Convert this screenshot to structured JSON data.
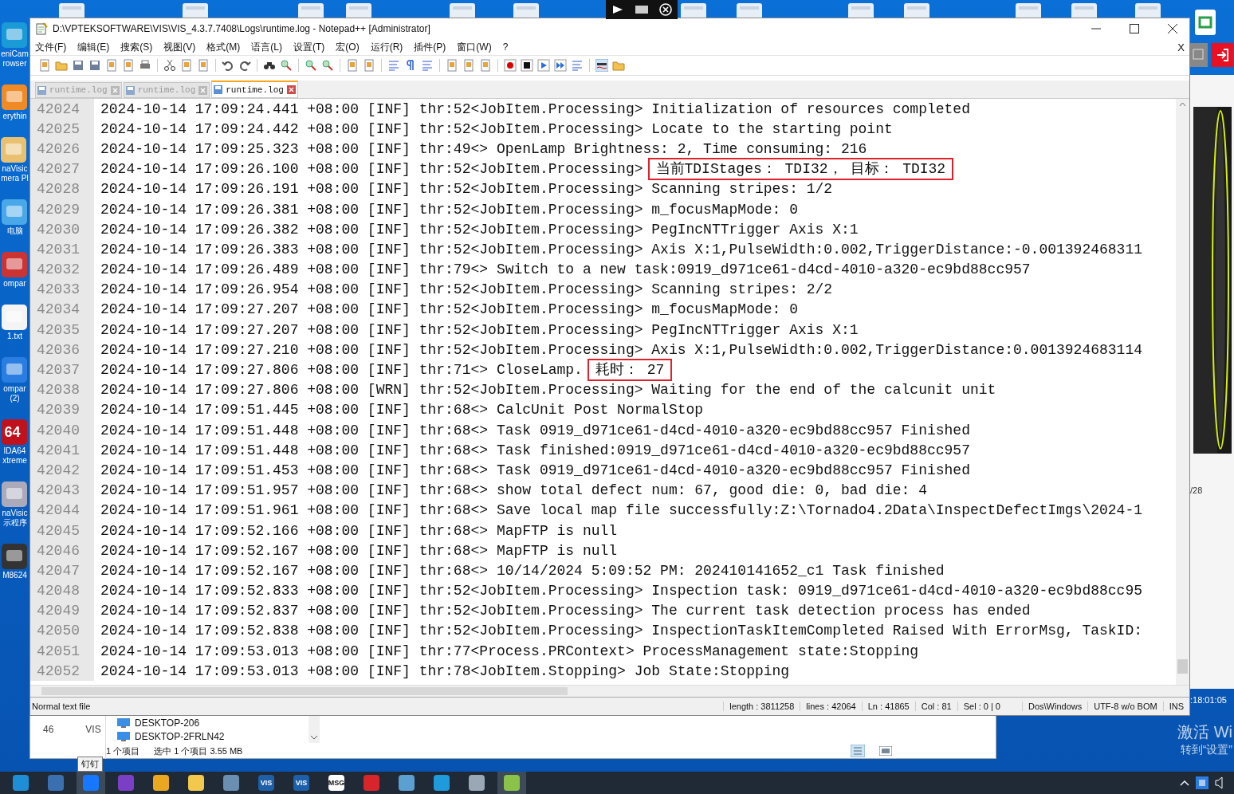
{
  "desktop": {
    "left_icons": [
      {
        "kind": "app",
        "labels": [
          "eniCam",
          "rowser"
        ]
      },
      {
        "kind": "search",
        "labels": [
          "erythin"
        ]
      },
      {
        "kind": "box",
        "labels": [
          "naVisic",
          "mera Pl"
        ]
      },
      {
        "kind": "pc",
        "labels": [
          "电脑"
        ]
      },
      {
        "kind": "disc",
        "labels": [
          "ompar"
        ]
      },
      {
        "kind": "file",
        "labels": [
          "1.txt"
        ]
      },
      {
        "kind": "doc",
        "labels": [
          "ompar",
          "(2)"
        ]
      },
      {
        "kind": "aida",
        "badge": "64",
        "labels": [
          "IDA64",
          "xtreme"
        ]
      },
      {
        "kind": "camera",
        "labels": [
          "naVisic",
          "示程序"
        ]
      },
      {
        "kind": "device",
        "labels": [
          "M8624"
        ]
      }
    ],
    "page_counter": "/28",
    "clock": ":18:01:05",
    "activation": [
      "激活 Wi",
      "转到“设置”"
    ]
  },
  "window": {
    "title": "D:\\VPTEKSOFTWARE\\VIS\\VIS_4.3.7.7408\\Logs\\runtime.log - Notepad++ [Administrator]",
    "menu": [
      "文件(F)",
      "编辑(E)",
      "搜索(S)",
      "视图(V)",
      "格式(M)",
      "语言(L)",
      "设置(T)",
      "宏(O)",
      "运行(R)",
      "插件(P)",
      "窗口(W)",
      "?"
    ],
    "close_doc": "X",
    "tabs": [
      {
        "label": "runtime.log",
        "selected": false
      },
      {
        "label": "runtime.log",
        "selected": false
      },
      {
        "label": "runtime.log",
        "selected": true
      }
    ],
    "lines": [
      {
        "number": "42024",
        "text": "2024-10-14 17:09:24.441 +08:00 [INF] thr:52<JobItem.Processing> Initialization of resources completed"
      },
      {
        "number": "42025",
        "text": "2024-10-14 17:09:24.442 +08:00 [INF] thr:52<JobItem.Processing> Locate to the starting point"
      },
      {
        "number": "42026",
        "text": "2024-10-14 17:09:25.323 +08:00 [INF] thr:49<> OpenLamp Brightness: 2, Time consuming: 216"
      },
      {
        "number": "42027",
        "text": "2024-10-14 17:09:26.100 +08:00 [INF] thr:52<JobItem.Processing>",
        "boxed": "当前TDIStages： TDI32， 目标： TDI32"
      },
      {
        "number": "42028",
        "text": "2024-10-14 17:09:26.191 +08:00 [INF] thr:52<JobItem.Processing> Scanning stripes: 1/2"
      },
      {
        "number": "42029",
        "text": "2024-10-14 17:09:26.381 +08:00 [INF] thr:52<JobItem.Processing> m_focusMapMode: 0"
      },
      {
        "number": "42030",
        "text": "2024-10-14 17:09:26.382 +08:00 [INF] thr:52<JobItem.Processing> PegIncNTTrigger Axis X:1"
      },
      {
        "number": "42031",
        "text": "2024-10-14 17:09:26.383 +08:00 [INF] thr:52<JobItem.Processing> Axis X:1,PulseWidth:0.002,TriggerDistance:-0.001392468311"
      },
      {
        "number": "42032",
        "text": "2024-10-14 17:09:26.489 +08:00 [INF] thr:79<> Switch to a new task:0919_d971ce61-d4cd-4010-a320-ec9bd88cc957"
      },
      {
        "number": "42033",
        "text": "2024-10-14 17:09:26.954 +08:00 [INF] thr:52<JobItem.Processing> Scanning stripes: 2/2"
      },
      {
        "number": "42034",
        "text": "2024-10-14 17:09:27.207 +08:00 [INF] thr:52<JobItem.Processing> m_focusMapMode: 0"
      },
      {
        "number": "42035",
        "text": "2024-10-14 17:09:27.207 +08:00 [INF] thr:52<JobItem.Processing> PegIncNTTrigger Axis X:1"
      },
      {
        "number": "42036",
        "text": "2024-10-14 17:09:27.210 +08:00 [INF] thr:52<JobItem.Processing> Axis X:1,PulseWidth:0.002,TriggerDistance:0.0013924683114"
      },
      {
        "number": "42037",
        "text": "2024-10-14 17:09:27.806 +08:00 [INF] thr:71<> CloseLamp.",
        "boxed": "耗时： 27"
      },
      {
        "number": "42038",
        "text": "2024-10-14 17:09:27.806 +08:00 [WRN] thr:52<JobItem.Processing> Waiting for the end of the calcunit unit"
      },
      {
        "number": "42039",
        "text": "2024-10-14 17:09:51.445 +08:00 [INF] thr:68<> CalcUnit Post NormalStop"
      },
      {
        "number": "42040",
        "text": "2024-10-14 17:09:51.448 +08:00 [INF] thr:68<> Task 0919_d971ce61-d4cd-4010-a320-ec9bd88cc957 Finished"
      },
      {
        "number": "42041",
        "text": "2024-10-14 17:09:51.448 +08:00 [INF] thr:68<> Task finished:0919_d971ce61-d4cd-4010-a320-ec9bd88cc957"
      },
      {
        "number": "42042",
        "text": "2024-10-14 17:09:51.453 +08:00 [INF] thr:68<> Task 0919_d971ce61-d4cd-4010-a320-ec9bd88cc957 Finished"
      },
      {
        "number": "42043",
        "text": "2024-10-14 17:09:51.957 +08:00 [INF] thr:68<> show total defect num: 67, good die: 0, bad die: 4"
      },
      {
        "number": "42044",
        "text": "2024-10-14 17:09:51.961 +08:00 [INF] thr:68<> Save local map file successfully:Z:\\Tornado4.2Data\\InspectDefectImgs\\2024-1"
      },
      {
        "number": "42045",
        "text": "2024-10-14 17:09:52.166 +08:00 [INF] thr:68<> MapFTP is null"
      },
      {
        "number": "42046",
        "text": "2024-10-14 17:09:52.167 +08:00 [INF] thr:68<> MapFTP is null"
      },
      {
        "number": "42047",
        "text": "2024-10-14 17:09:52.167 +08:00 [INF] thr:68<> 10/14/2024 5:09:52 PM: 202410141652_c1 Task finished"
      },
      {
        "number": "42048",
        "text": "2024-10-14 17:09:52.833 +08:00 [INF] thr:52<JobItem.Processing> Inspection task: 0919_d971ce61-d4cd-4010-a320-ec9bd88cc95"
      },
      {
        "number": "42049",
        "text": "2024-10-14 17:09:52.837 +08:00 [INF] thr:52<JobItem.Processing> The current task detection process has ended"
      },
      {
        "number": "42050",
        "text": "2024-10-14 17:09:52.838 +08:00 [INF] thr:52<JobItem.Processing> InspectionTaskItemCompleted Raised With ErrorMsg, TaskID:"
      },
      {
        "number": "42051",
        "text": "2024-10-14 17:09:53.013 +08:00 [INF] thr:77<Process.PRContext> ProcessManagement state:Stopping"
      },
      {
        "number": "42052",
        "text": "2024-10-14 17:09:53.013 +08:00 [INF] thr:78<JobItem.Stopping> Job State:Stopping"
      }
    ],
    "status_bar": {
      "file_type": "Normal text file",
      "fields": [
        "length : 3811258",
        "lines : 42064",
        "Ln : 41865",
        "Col : 81",
        "Sel : 0 | 0"
      ],
      "eol": "Dos\\Windows",
      "encoding": "UTF-8 w/o BOM",
      "mode": "INS"
    }
  },
  "explorer": {
    "column_1": "46",
    "column_2": "VIS",
    "items": [
      "DESKTOP-206",
      "DESKTOP-2FRLN42"
    ],
    "status": [
      "1 个项目",
      "选中 1 个项目  3.55 MB"
    ]
  },
  "tooltip": "钉钉",
  "taskbar": [
    {
      "kind": "edge",
      "highlighted": false
    },
    {
      "kind": "remote",
      "highlighted": false
    },
    {
      "kind": "arrow",
      "highlighted": true
    },
    {
      "kind": "vs",
      "highlighted": false
    },
    {
      "kind": "slack",
      "highlighted": false
    },
    {
      "kind": "folder",
      "highlighted": false
    },
    {
      "kind": "network",
      "highlighted": false
    },
    {
      "kind": "vis",
      "label": "VIS",
      "highlighted": false
    },
    {
      "kind": "vis",
      "label": "VIS",
      "highlighted": false
    },
    {
      "kind": "msg",
      "label": "MSG",
      "highlighted": false
    },
    {
      "kind": "red",
      "highlighted": false
    },
    {
      "kind": "lock",
      "highlighted": false
    },
    {
      "kind": "tile",
      "highlighted": false
    },
    {
      "kind": "monitor",
      "highlighted": false
    },
    {
      "kind": "notepad",
      "highlighted": true
    }
  ]
}
